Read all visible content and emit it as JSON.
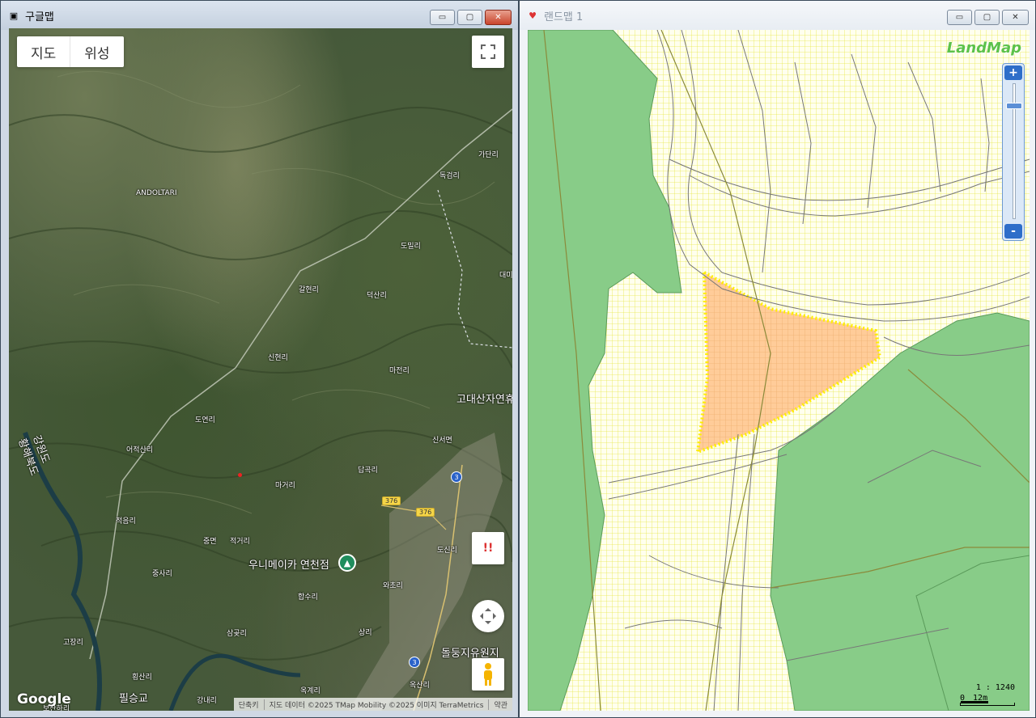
{
  "left_window": {
    "title": "구글맵",
    "icon": "google-map-app-icon",
    "controls": {
      "minimize": "▭",
      "maximize": "▢",
      "close": "✕"
    },
    "map_type": {
      "map": "지도",
      "satellite": "위성",
      "selected": "위성"
    },
    "place_labels": [
      {
        "name": "ANDOLTARI",
        "size": "small"
      },
      {
        "name": "가단리",
        "size": "small"
      },
      {
        "name": "독검리",
        "size": "small"
      },
      {
        "name": "도밀리",
        "size": "small"
      },
      {
        "name": "대미",
        "size": "small"
      },
      {
        "name": "갈현리",
        "size": "small"
      },
      {
        "name": "덕산리",
        "size": "small"
      },
      {
        "name": "신현리",
        "size": "small"
      },
      {
        "name": "마전리",
        "size": "small"
      },
      {
        "name": "고대산자연휴",
        "size": "big"
      },
      {
        "name": "도연리",
        "size": "small"
      },
      {
        "name": "신서면",
        "size": "small"
      },
      {
        "name": "어적산리",
        "size": "small"
      },
      {
        "name": "답곡리",
        "size": "small"
      },
      {
        "name": "마거리",
        "size": "small"
      },
      {
        "name": "적음리",
        "size": "small"
      },
      {
        "name": "중면",
        "size": "small"
      },
      {
        "name": "적거리",
        "size": "small"
      },
      {
        "name": "도신리",
        "size": "small"
      },
      {
        "name": "우니메이카 연천점",
        "size": "big"
      },
      {
        "name": "중사리",
        "size": "small"
      },
      {
        "name": "와초리",
        "size": "small"
      },
      {
        "name": "합수리",
        "size": "small"
      },
      {
        "name": "삼곶리",
        "size": "small"
      },
      {
        "name": "상리",
        "size": "small"
      },
      {
        "name": "고장리",
        "size": "small"
      },
      {
        "name": "돌둥지유원지",
        "size": "big"
      },
      {
        "name": "횡산리",
        "size": "small"
      },
      {
        "name": "옥계리",
        "size": "small"
      },
      {
        "name": "옥산리",
        "size": "small"
      },
      {
        "name": "강내리",
        "size": "small"
      },
      {
        "name": "필승교",
        "size": "big"
      },
      {
        "name": "보산하리",
        "size": "small"
      }
    ],
    "region_labels": {
      "gangwon": "강원도",
      "hwanghae": "황해북도"
    },
    "routes": {
      "r376a": "376",
      "r376b": "376",
      "r3a": "3",
      "r3b": "3"
    },
    "warning_label": "!!",
    "google_logo": "Google",
    "attribution": [
      "단축키",
      "지도 데이터 ©2025 TMap Mobility ©2025 이미지 TerraMetrics",
      "약관"
    ]
  },
  "right_window": {
    "title": "랜드맵 1",
    "icon": "landmap-app-icon",
    "controls": {
      "minimize": "▭",
      "maximize": "▢",
      "close": "✕"
    },
    "logo": "LandMap",
    "zoom_in": "+",
    "zoom_out": "-",
    "zoom_level": 0.15,
    "scale_ratio": "1 : 1240",
    "scale_start": "0",
    "scale_end": "12m",
    "colors": {
      "parcel_yellow": "#ffff66",
      "forest_green": "#88cc88",
      "selected_parcel": "#ffcc99",
      "highlight_border": "#ffee00"
    }
  }
}
